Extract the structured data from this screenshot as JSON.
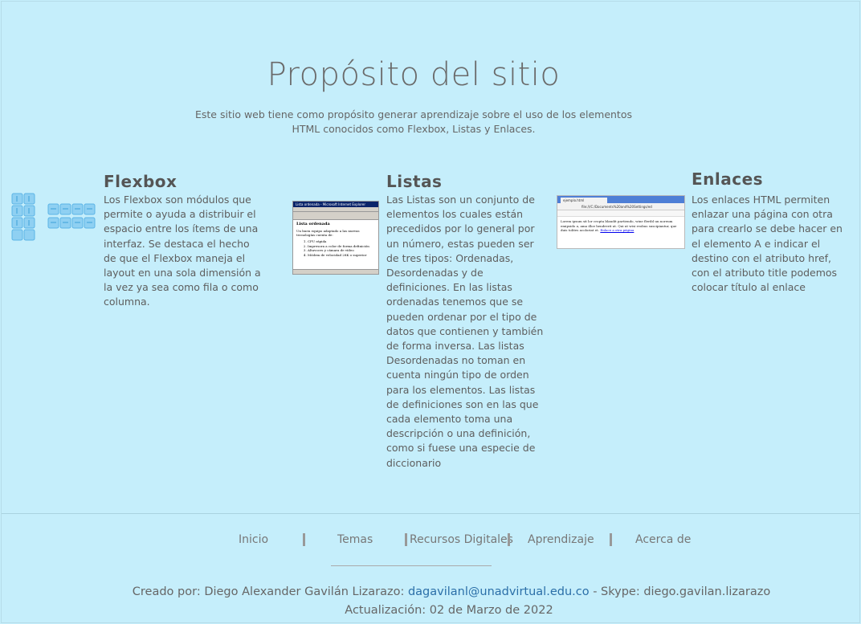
{
  "header": {
    "title": "Propósito del sitio",
    "intro": "Este sitio web tiene como propósito generar aprendizaje sobre el uso de los elementos HTML conocidos como Flexbox, Listas y Enlaces."
  },
  "sections": [
    {
      "title": "Flexbox",
      "text": "Los Flexbox son módulos que permite o ayuda a distribuir el espacio entre los ítems de una interfaz. Se destaca el hecho de que el Flexbox maneja el layout en una sola dimensión a la vez ya sea como fila o como columna."
    },
    {
      "title": "Listas",
      "text": "Las Listas son un conjunto de elementos los cuales están precedidos por lo general por un número, estas pueden ser de tres tipos: Ordenadas, Desordenadas y de definiciones. En las listas ordenadas tenemos que se pueden ordenar por el tipo de datos que contienen y también de forma inversa. Las listas Desordenadas no toman en cuenta ningún tipo de orden para los elementos. Las listas de definiciones son en las que cada elemento toma una descripción o una definición, como si fuese una especie de diccionario"
    },
    {
      "title": "Enlaces",
      "text": "Los enlaces HTML permiten enlazar una página con otra para crearlo se debe hacer en el elemento A e indicar el destino con el atributo href, con el atributo title podemos colocar título al enlace"
    }
  ],
  "list_screenshot": {
    "window_title": "Lista ordenada - Microsoft Internet Explorer",
    "heading": "Lista ordenada",
    "intro": "Un buen equipo adaptado a las nuevas tecnologías cuenta de:",
    "items": [
      "CPU rápida",
      "Impresora a color de forma definición",
      "Altavoces y cámara de vídeo",
      "Módem de velocidad 28K o superior"
    ]
  },
  "link_screenshot": {
    "tab": "ejemplo.html",
    "address": "file:///C:/Documents%20and%20Settings/ed",
    "body": "Lorem ipsum sit lor cropta blandit partiendo, wine fleribl un noreum emipsido a, ama illoe hendrerit ut. Qui ut wisi reobus suscipiantur, que duis tolites acoloriat et.",
    "link": "Enlace a otra página"
  },
  "footer": {
    "nav": [
      "Inicio",
      "Temas",
      "Recursos Digitales",
      "Aprendizaje",
      "Acerca de"
    ],
    "credit_prefix": "Creado por: Diego Alexander Gavilán Lizarazo: ",
    "email": "dagavilanl@unadvirtual.edu.co",
    "credit_suffix": " - Skype: diego.gavilan.lizarazo",
    "update": "Actualización: 02 de Marzo de 2022"
  },
  "colors": {
    "background": "#c5eefb",
    "link": "#2b6fa8",
    "flex_icon": "#7cc6ef"
  }
}
